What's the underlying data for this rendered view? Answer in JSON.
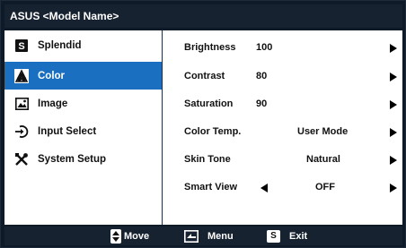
{
  "title": "ASUS <Model Name>",
  "menu": {
    "items": [
      {
        "label": "Splendid",
        "icon": "splendid-s-icon",
        "selected": false
      },
      {
        "label": "Color",
        "icon": "color-palette-icon",
        "selected": true
      },
      {
        "label": "Image",
        "icon": "image-icon",
        "selected": false
      },
      {
        "label": "Input Select",
        "icon": "input-select-icon",
        "selected": false
      },
      {
        "label": "System Setup",
        "icon": "tools-icon",
        "selected": false
      }
    ]
  },
  "settings": {
    "brightness": {
      "label": "Brightness",
      "value": "100"
    },
    "contrast": {
      "label": "Contrast",
      "value": "80"
    },
    "saturation": {
      "label": "Saturation",
      "value": "90"
    },
    "color_temp": {
      "label": "Color Temp.",
      "value": "User Mode"
    },
    "skin_tone": {
      "label": "Skin Tone",
      "value": "Natural"
    },
    "smart_view": {
      "label": "Smart View",
      "value": "OFF"
    }
  },
  "footer": {
    "move": "Move",
    "menu": "Menu",
    "exit": "Exit",
    "exit_badge": "S"
  },
  "colors": {
    "frame": "#172231",
    "selection": "#1b6fc0",
    "panel": "#ffffff"
  }
}
